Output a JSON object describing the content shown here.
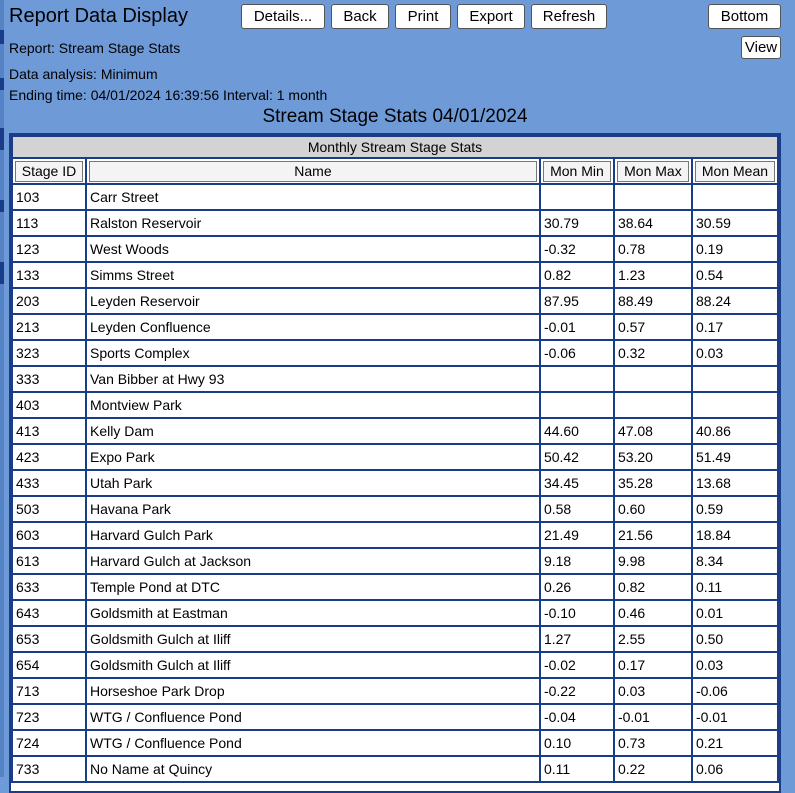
{
  "app": {
    "title": "Report Data Display"
  },
  "toolbar": {
    "details_label": "Details...",
    "back_label": "Back",
    "print_label": "Print",
    "export_label": "Export",
    "refresh_label": "Refresh",
    "bottom_label": "Bottom",
    "view_label": "View"
  },
  "info": {
    "report": "Report: Stream Stage Stats",
    "analysis": "Data analysis: Minimum",
    "ending": "Ending time: 04/01/2024 16:39:56 Interval: 1 month"
  },
  "report_title": "Stream Stage Stats 04/01/2024",
  "table": {
    "caption": "Monthly Stream Stage Stats",
    "headers": [
      "Stage ID",
      "Name",
      "Mon Min",
      "Mon Max",
      "Mon Mean"
    ],
    "rows": [
      [
        "103",
        "Carr Street",
        "",
        "",
        ""
      ],
      [
        "113",
        "Ralston Reservoir",
        "30.79",
        "38.64",
        "30.59"
      ],
      [
        "123",
        "West Woods",
        "-0.32",
        "0.78",
        "0.19"
      ],
      [
        "133",
        "Simms Street",
        "0.82",
        "1.23",
        "0.54"
      ],
      [
        "203",
        "Leyden Reservoir",
        "87.95",
        "88.49",
        "88.24"
      ],
      [
        "213",
        "Leyden Confluence",
        "-0.01",
        "0.57",
        "0.17"
      ],
      [
        "323",
        "Sports Complex",
        "-0.06",
        "0.32",
        "0.03"
      ],
      [
        "333",
        "Van Bibber at Hwy 93",
        "",
        "",
        ""
      ],
      [
        "403",
        "Montview Park",
        "",
        "",
        ""
      ],
      [
        "413",
        "Kelly Dam",
        "44.60",
        "47.08",
        "40.86"
      ],
      [
        "423",
        "Expo Park",
        "50.42",
        "53.20",
        "51.49"
      ],
      [
        "433",
        "Utah Park",
        "34.45",
        "35.28",
        "13.68"
      ],
      [
        "503",
        "Havana Park",
        "0.58",
        "0.60",
        "0.59"
      ],
      [
        "603",
        "Harvard Gulch Park",
        "21.49",
        "21.56",
        "18.84"
      ],
      [
        "613",
        "Harvard Gulch at Jackson",
        "9.18",
        "9.98",
        "8.34"
      ],
      [
        "633",
        "Temple Pond at DTC",
        "0.26",
        "0.82",
        "0.11"
      ],
      [
        "643",
        "Goldsmith at Eastman",
        "-0.10",
        "0.46",
        "0.01"
      ],
      [
        "653",
        "Goldsmith Gulch at Iliff",
        "1.27",
        "2.55",
        "0.50"
      ],
      [
        "654",
        "Goldsmith Gulch at Iliff",
        "-0.02",
        "0.17",
        "0.03"
      ],
      [
        "713",
        "Horseshoe Park Drop",
        "-0.22",
        "0.03",
        "-0.06"
      ],
      [
        "723",
        "WTG / Confluence Pond",
        "-0.04",
        "-0.01",
        "-0.01"
      ],
      [
        "724",
        "WTG / Confluence Pond",
        "0.10",
        "0.73",
        "0.21"
      ],
      [
        "733",
        "No Name at Quincy",
        "0.11",
        "0.22",
        "0.06"
      ]
    ]
  }
}
